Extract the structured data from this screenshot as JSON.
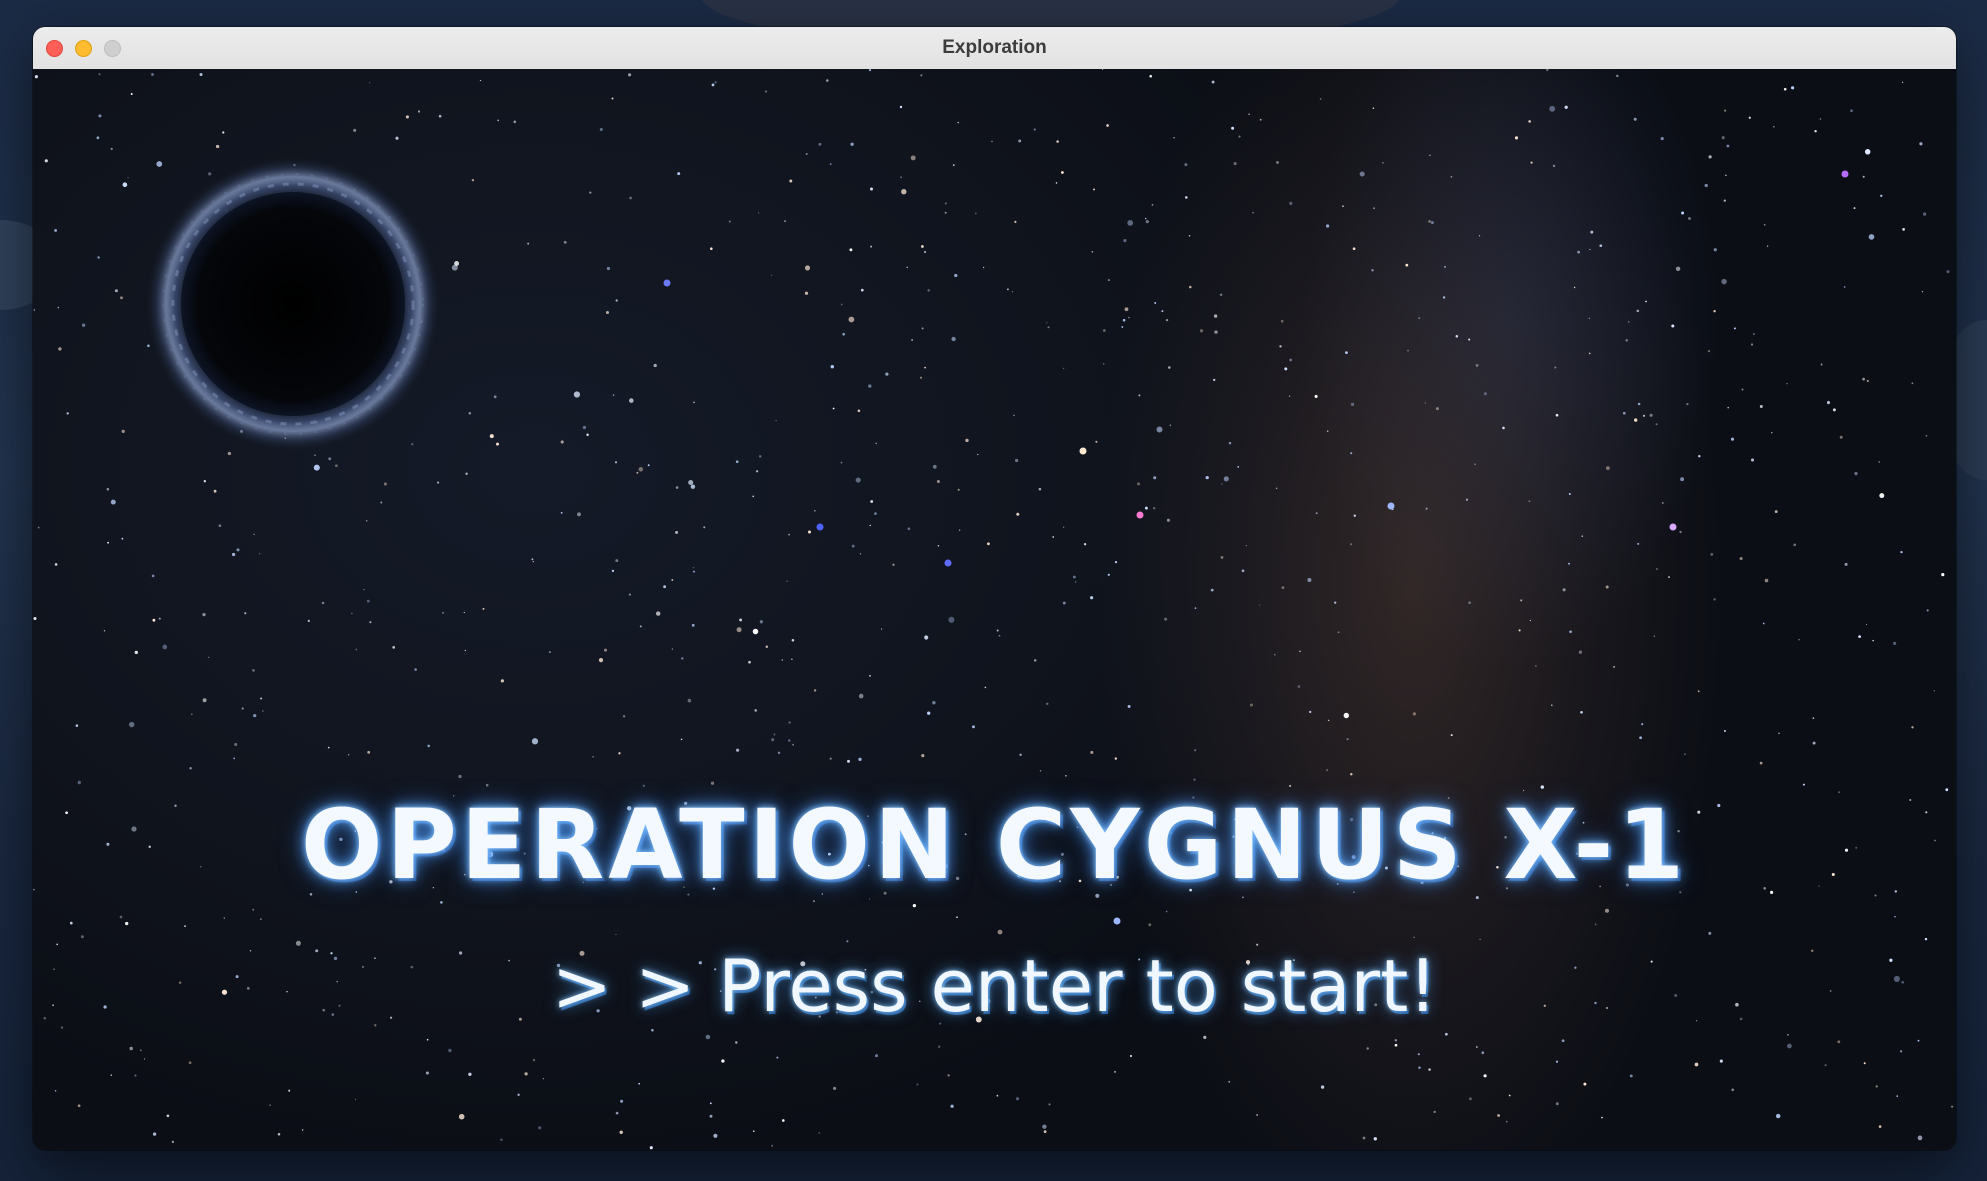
{
  "window": {
    "title": "Exploration"
  },
  "game": {
    "title": "OPERATION CYGNUS X-1",
    "prompt": "> > Press enter to start!"
  },
  "colors": {
    "title_glow": "#5aa0ff",
    "text": "#f4f8ff",
    "space_background": "#10141d"
  }
}
